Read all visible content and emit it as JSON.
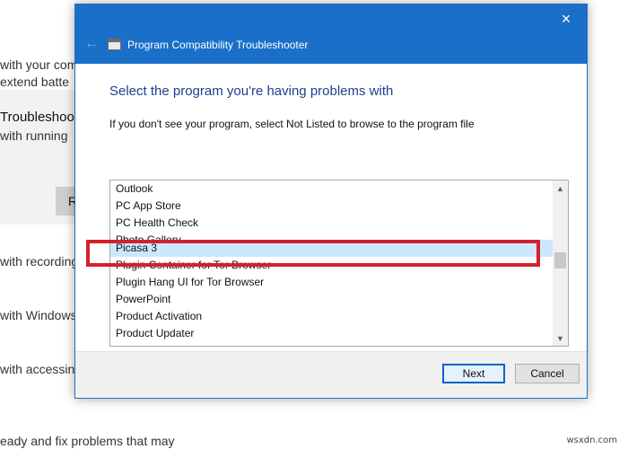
{
  "background": {
    "lines": [
      "with your com",
      "extend batte",
      "with running",
      "with recording",
      "with Windows",
      "with accessing",
      "eady and fix problems that may"
    ],
    "troubleshoot_label": "Troubleshoo",
    "run_button_label": "R"
  },
  "watermark": "wsxdn.com",
  "dialog": {
    "title": "Program Compatibility Troubleshooter",
    "close_icon": "×",
    "back_icon": "←",
    "heading": "Select the program you're having problems with",
    "instruction": "If you don't see your program, select Not Listed to browse to the program file",
    "list": {
      "items": [
        "Outlook",
        "PC App Store",
        "PC Health Check",
        "Photo Gallery",
        "Picasa 3",
        "Plugin Container for Tor Browser",
        "Plugin Hang UI for Tor Browser",
        "PowerPoint",
        "Product Activation",
        "Product Updater"
      ],
      "selected_index": 4,
      "scroll_up_icon": "▲",
      "scroll_down_icon": "▼"
    },
    "buttons": {
      "next": "Next",
      "cancel": "Cancel"
    }
  },
  "colors": {
    "titlebar": "#1a6fc9",
    "selection": "#cce8ff",
    "highlight": "#d3212b",
    "heading": "#1c3f8f"
  }
}
